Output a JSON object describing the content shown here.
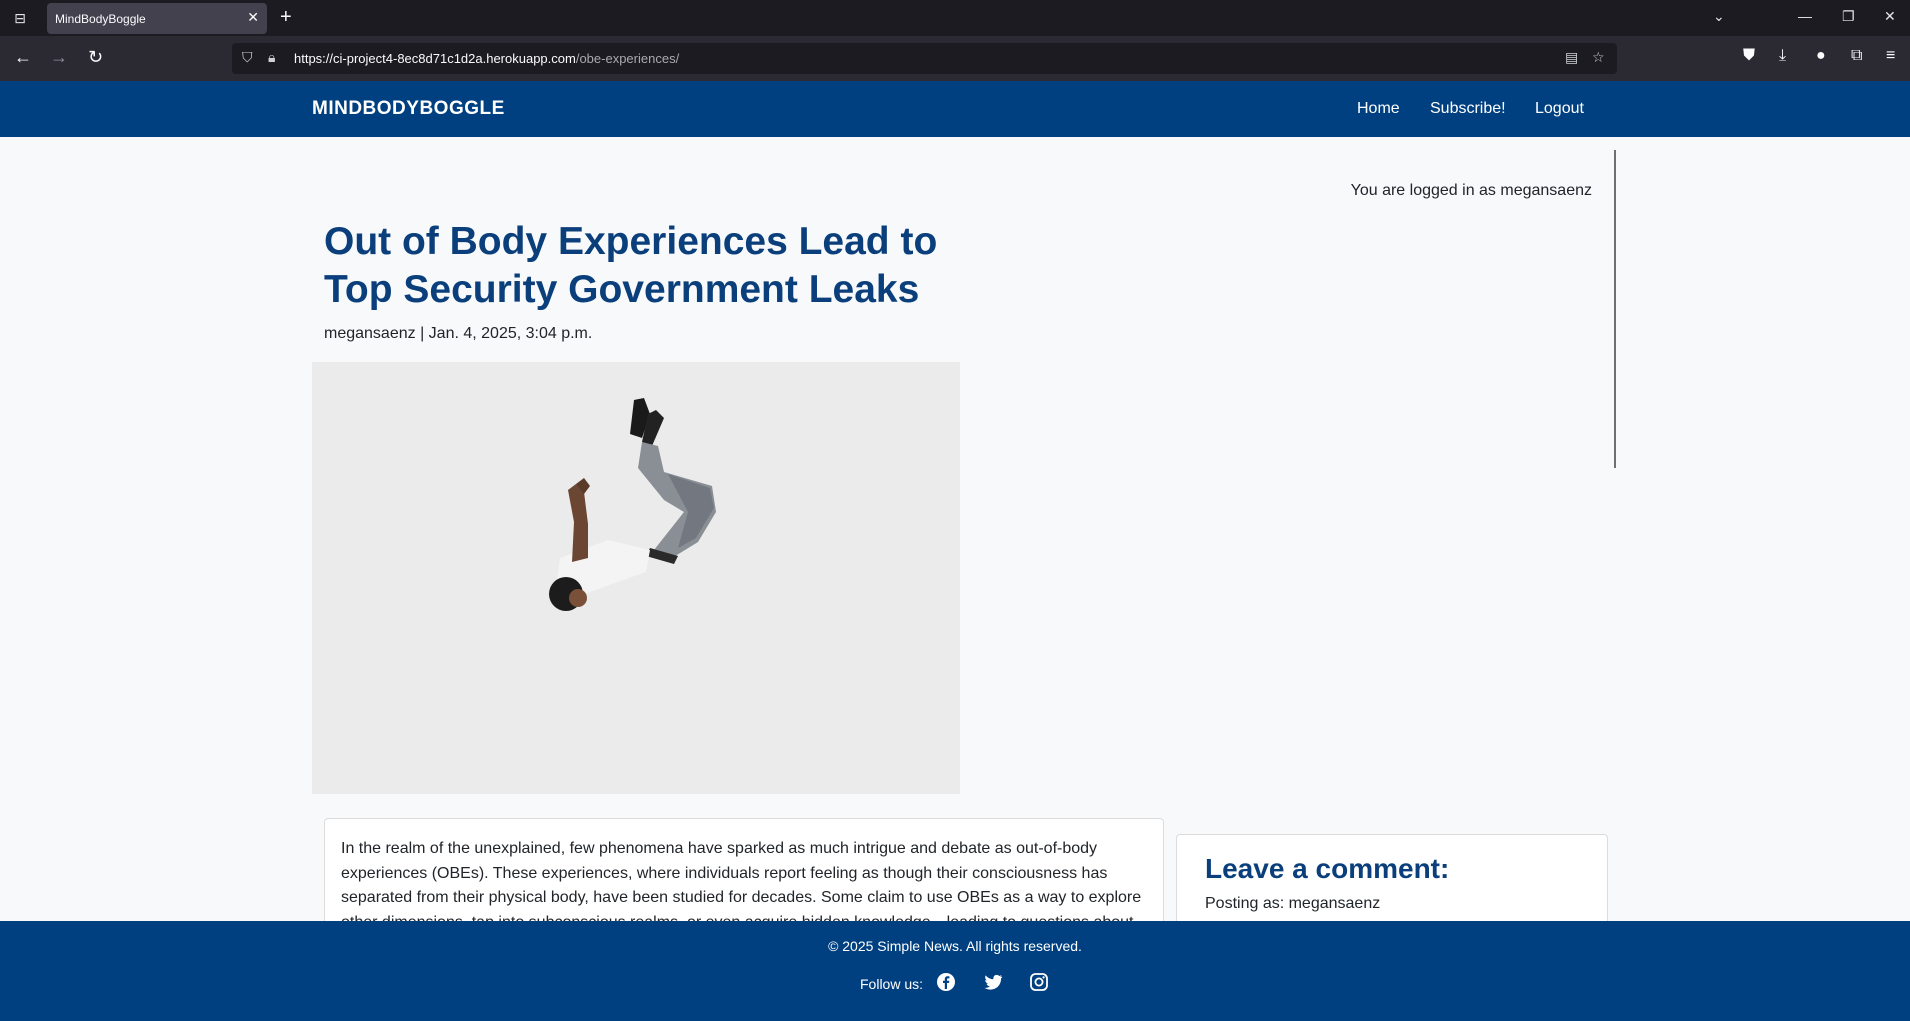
{
  "browser": {
    "tab_title": "MindBodyBoggle",
    "url_main": "https://ci-project4-8ec8d71c1d2a.herokuapp.com",
    "url_path": "/obe-experiences/"
  },
  "site": {
    "brand": "MINDBODYBOGGLE",
    "nav": [
      "Home",
      "Subscribe!",
      "Logout"
    ]
  },
  "sidebar": {
    "login_status": "You are logged in as megansaenz"
  },
  "post": {
    "title": "Out of Body Experiences Lead to Top Security Government Leaks",
    "meta": "megansaenz | Jan. 4, 2025, 3:04 p.m.",
    "body": "In the realm of the unexplained, few phenomena have sparked as much intrigue and debate as out-of-body experiences (OBEs). These experiences, where individuals report feeling as though their consciousness has separated from their physical body, have been studied for decades. Some claim to use OBEs as a way to explore other dimensions, tap into subconscious realms, or even acquire hidden knowledge—leading to questions about"
  },
  "comments": {
    "title": "Leave a comment:",
    "posting_as": "Posting as: megansaenz"
  },
  "footer": {
    "copyright": "© 2025 Simple News. All rights reserved.",
    "follow": "Follow us:"
  },
  "colors": {
    "brand_blue": "#004080",
    "title_blue": "#0b3f7c"
  }
}
